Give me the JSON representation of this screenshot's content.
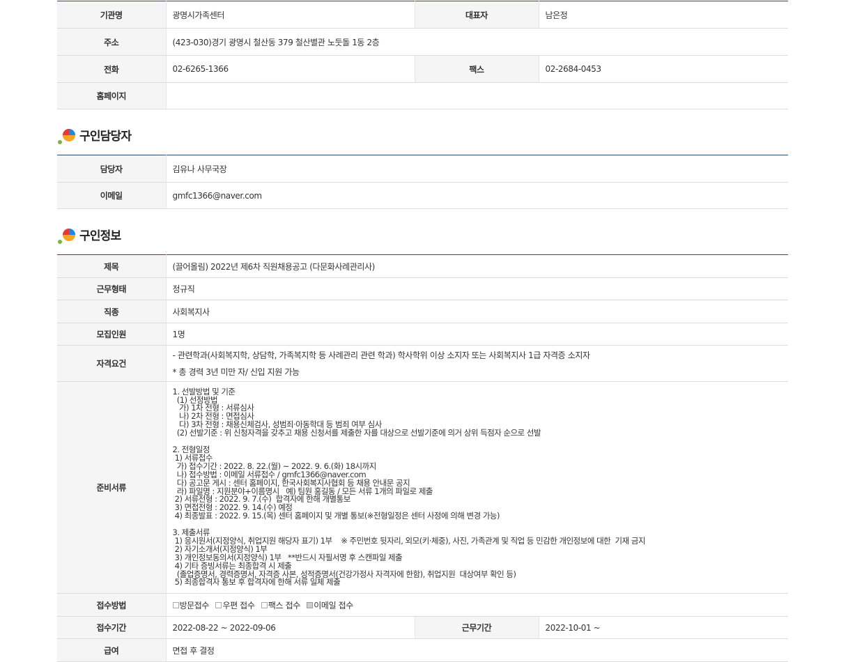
{
  "institution": {
    "name_label": "기관명",
    "name": "광명시가족센터",
    "rep_label": "대표자",
    "rep": "남은정",
    "addr_label": "주소",
    "addr": "(423-030)경기 광명시 철산동 379 철산별관 노둣돌 1동 2층",
    "tel_label": "전화",
    "tel": "02-6265-1366",
    "fax_label": "팩스",
    "fax": "02-2684-0453",
    "homepage_label": "홈페이지",
    "homepage": ""
  },
  "manager_section": {
    "title": "구인담당자",
    "person_label": "담당자",
    "person": "김유나 사무국장",
    "email_label": "이메일",
    "email": "gmfc1366@naver.com"
  },
  "job_section": {
    "title": "구인정보",
    "subject_label": "제목",
    "subject": "(끌어올림) 2022년 제6차 직원채용공고 (다문화사례관리사)",
    "worktype_label": "근무형태",
    "worktype": "정규직",
    "jobtype_label": "직종",
    "jobtype": "사회복지사",
    "headcount_label": "모집인원",
    "headcount": "1명",
    "qual_label": "자격요건",
    "qual_line1": "- 관련학과(사회복지학, 상담학, 가족복지학 등 사례관리 관련 학과) 학사학위 이상 소지자 또는 사회복지사 1급 자격증 소지자",
    "qual_line2": "* 총 경력 3년 미만 자/ 신입 지원 가능",
    "docs_label": "준비서류",
    "docs_text": "1. 선발방법 및 기준\n  (1) 선정방법\n   가) 1차 전형 : 서류심사\n   나) 2차 전형 : 면접심사\n   다) 3차 전형 : 채용신체검사, 성범죄·아동학대 등 범죄 여부 심사\n  (2) 선발기준 : 위 신청자격을 갖추고 채용 신청서를 제출한 자를 대상으로 선발기준에 의거 상위 득점자 순으로 선발\n\n2. 전형일정\n 1) 서류접수\n  가) 접수기간 : 2022. 8. 22.(월) ~ 2022. 9. 6.(화) 18시까지\n  나) 접수방법 : 이메일 서류접수 / gmfc1366@naver.com\n  다) 공고문 게시 : 센터 홈페이지, 한국사회복지사협회 등 채용 안내문 공지\n  라) 파일명 : 지원분야+이름명시   예) 팀원 홍길동 / 모든 서류 1개의 파일로 제출\n 2) 서류전형 : 2022. 9. 7.(수)  합격자에 한해 개별통보\n 3) 면접전형 : 2022. 9. 14.(수) 예정\n 4) 최종발표 : 2022. 9. 15.(목) 센터 홈페이지 및 개별 통보(※전형일정은 센터 사정에 의해 변경 가능)\n\n3. 제출서류\n 1) 응시원서(지정양식, 취업지원 해당자 표기) 1부    ※ 주민번호 뒷자리, 외모(키·체중), 사진, 가족관계 및 직업 등 민감한 개인정보에 대한  기재 금지\n 2) 자기소개서(지정양식) 1부\n 3) 개인정보동의서(지정양식) 1부   **반드시 자필서명 후 스캔파일 제출\n 4) 기타 증빙서류는 최종합격 시 제출\n  (졸업증명서, 경력증명서, 자격증 사본, 성적증명서(건강가정사 자격자에 한함), 취업지원  대상여부 확인 등)\n 5) 최종합격자 통보 후 합격자에 한해 서류 일체 제출",
    "method_label": "접수방법",
    "methods": [
      {
        "label": "방문접수",
        "checked": false
      },
      {
        "label": "우편 접수",
        "checked": false
      },
      {
        "label": "팩스 접수",
        "checked": false
      },
      {
        "label": "이메일 접수",
        "checked": true
      }
    ],
    "period_label": "접수기간",
    "period": "2022-08-22 ~ 2022-09-06",
    "workperiod_label": "근무기간",
    "workperiod": "2022-10-01 ~",
    "salary_label": "급여",
    "salary": "면접 후 결정"
  }
}
